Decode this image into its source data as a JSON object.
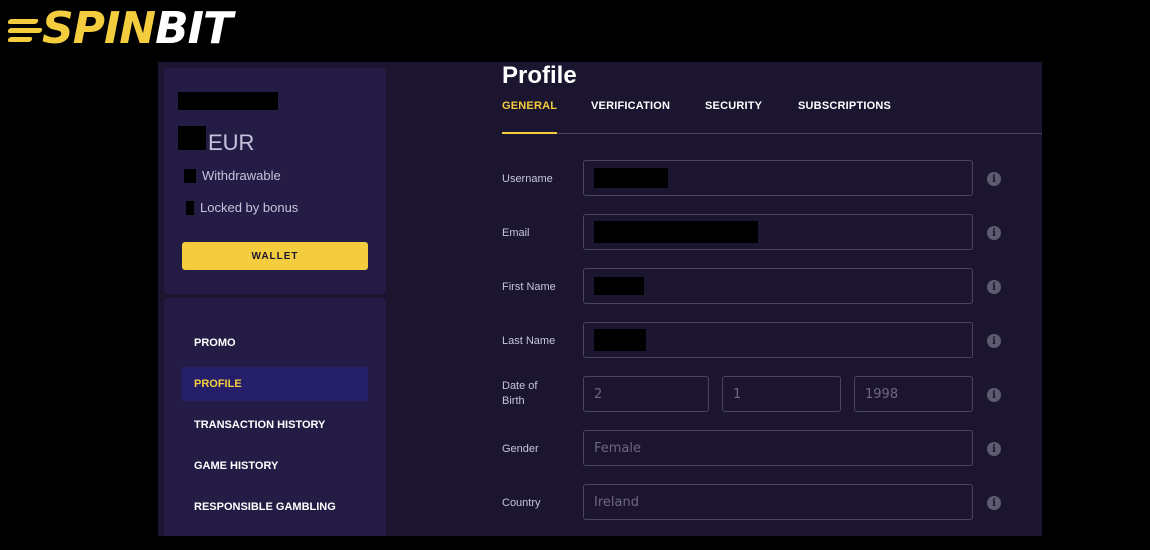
{
  "brand": {
    "logo_text_part1": "SPIN",
    "logo_text_part2": "BIT",
    "accent": "#f4cd3e"
  },
  "balance": {
    "currency": "EUR",
    "withdrawable_label": "Withdrawable",
    "locked_label": "Locked by bonus",
    "wallet_button": "WALLET"
  },
  "menu": {
    "items": [
      {
        "label": "PROMO"
      },
      {
        "label": "PROFILE"
      },
      {
        "label": "TRANSACTION HISTORY"
      },
      {
        "label": "GAME HISTORY"
      },
      {
        "label": "RESPONSIBLE GAMBLING"
      }
    ],
    "active": "PROFILE"
  },
  "page": {
    "title": "Profile"
  },
  "tabs": [
    {
      "label": "GENERAL"
    },
    {
      "label": "VERIFICATION"
    },
    {
      "label": "SECURITY"
    },
    {
      "label": "SUBSCRIPTIONS"
    }
  ],
  "form": {
    "username_label": "Username",
    "email_label": "Email",
    "first_name_label": "First Name",
    "last_name_label": "Last Name",
    "dob_label_line1": "Date of",
    "dob_label_line2": "Birth",
    "dob_day": "2",
    "dob_month": "1",
    "dob_year": "1998",
    "gender_label": "Gender",
    "gender_value": "Female",
    "country_label": "Country",
    "country_value": "Ireland"
  },
  "icons": {
    "info": "info-icon",
    "info_glyph": "i"
  }
}
